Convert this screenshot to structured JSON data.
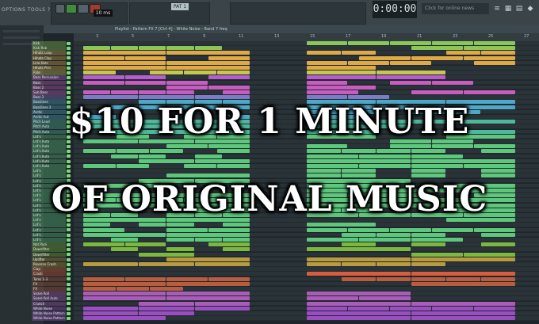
{
  "toolbar": {
    "title": "OPTIONS TOOLS ?",
    "tempo": "10 ms",
    "pattern": "PAT 1",
    "time": "0:00:00",
    "search_placeholder": "Click for online news"
  },
  "playlist": {
    "header": "Playlist - Pattern FX 7 [Ctrl 4] - White Noise - Band 7 freq",
    "ruler_ticks": [
      "3",
      "5",
      "7",
      "9",
      "11",
      "13",
      "15",
      "17",
      "19",
      "21",
      "23",
      "25",
      "27"
    ]
  },
  "tracks": [
    {
      "name": "Kick",
      "color": "#8fd05a"
    },
    {
      "name": "Kick Rvb",
      "color": "#8fd05a"
    },
    {
      "name": "Hihats Loop",
      "color": "#e8b048"
    },
    {
      "name": "Hihats Clap",
      "color": "#e8b048"
    },
    {
      "name": "Line Hats",
      "color": "#e8b048"
    },
    {
      "name": "Hihats Perc",
      "color": "#e8b048"
    },
    {
      "name": "Ride",
      "color": "#d0d050"
    },
    {
      "name": "Bass Percussion",
      "color": "#c060d8"
    },
    {
      "name": "Bass",
      "color": "#d060c8"
    },
    {
      "name": "Bass 2",
      "color": "#d060c8"
    },
    {
      "name": "Sub Bass",
      "color": "#d060c8"
    },
    {
      "name": "Bass 3",
      "color": "#8080d0"
    },
    {
      "name": "Basslines",
      "color": "#50b0d0"
    },
    {
      "name": "Basslines 2",
      "color": "#50b0d0"
    },
    {
      "name": "Arctic",
      "color": "#50b0d0"
    },
    {
      "name": "Arctic Aut",
      "color": "#50b0d0"
    },
    {
      "name": "Pitch Lead",
      "color": "#50c0a0"
    },
    {
      "name": "Pitch Auto",
      "color": "#50c0a0"
    },
    {
      "name": "Pitch Auto",
      "color": "#50c0a0"
    },
    {
      "name": "Lrd's",
      "color": "#60d080"
    },
    {
      "name": "Lrd's Auto",
      "color": "#60d080"
    },
    {
      "name": "Lrd's Auto",
      "color": "#60d080"
    },
    {
      "name": "Lrd's Auto",
      "color": "#60d080"
    },
    {
      "name": "Lrd's Auto",
      "color": "#60d080"
    },
    {
      "name": "Lrd's Auto",
      "color": "#60d080"
    },
    {
      "name": "Lrd's Auto",
      "color": "#60d080"
    },
    {
      "name": "Lrd's",
      "color": "#60d080"
    },
    {
      "name": "Lrd's",
      "color": "#60d080"
    },
    {
      "name": "Lrd's",
      "color": "#60d080"
    },
    {
      "name": "Lrd's",
      "color": "#60d080"
    },
    {
      "name": "Lrd's",
      "color": "#60d080"
    },
    {
      "name": "Lrd's",
      "color": "#60d080"
    },
    {
      "name": "Lrd's",
      "color": "#60d080"
    },
    {
      "name": "Lrd's",
      "color": "#60d080"
    },
    {
      "name": "Lrd's",
      "color": "#60d080"
    },
    {
      "name": "Lrd's",
      "color": "#60d080"
    },
    {
      "name": "Lrd's",
      "color": "#60d080"
    },
    {
      "name": "Lrd's",
      "color": "#60d080"
    },
    {
      "name": "Lrd's",
      "color": "#60d080"
    },
    {
      "name": "Lrd's",
      "color": "#60d080"
    },
    {
      "name": "Lrd's",
      "color": "#60d080"
    },
    {
      "name": "Nat Pack",
      "color": "#80c040"
    },
    {
      "name": "Downfilter",
      "color": "#80c040"
    },
    {
      "name": "Downfilter",
      "color": "#80c040"
    },
    {
      "name": "Uplifter",
      "color": "#c0a040"
    },
    {
      "name": "Reverse Crash",
      "color": "#c0a040"
    },
    {
      "name": "Clap",
      "color": "#e07040"
    },
    {
      "name": "Crash",
      "color": "#e06040"
    },
    {
      "name": "Toms 1-3",
      "color": "#c06040"
    },
    {
      "name": "FX",
      "color": "#c06040"
    },
    {
      "name": "FX",
      "color": "#c06040"
    },
    {
      "name": "Snare Roll",
      "color": "#b060c0"
    },
    {
      "name": "Snare Roll Auto",
      "color": "#b060c0"
    },
    {
      "name": "Crunch",
      "color": "#b060c0"
    },
    {
      "name": "White Noise",
      "color": "#a050c8"
    },
    {
      "name": "White Noise Pattern",
      "color": "#a050c8"
    },
    {
      "name": "White Noise Pattern",
      "color": "#a050c8"
    }
  ],
  "headline": {
    "line1": "$10 FOR 1 MINUTE",
    "line2": "OF ORIGINAL MUSIC"
  }
}
